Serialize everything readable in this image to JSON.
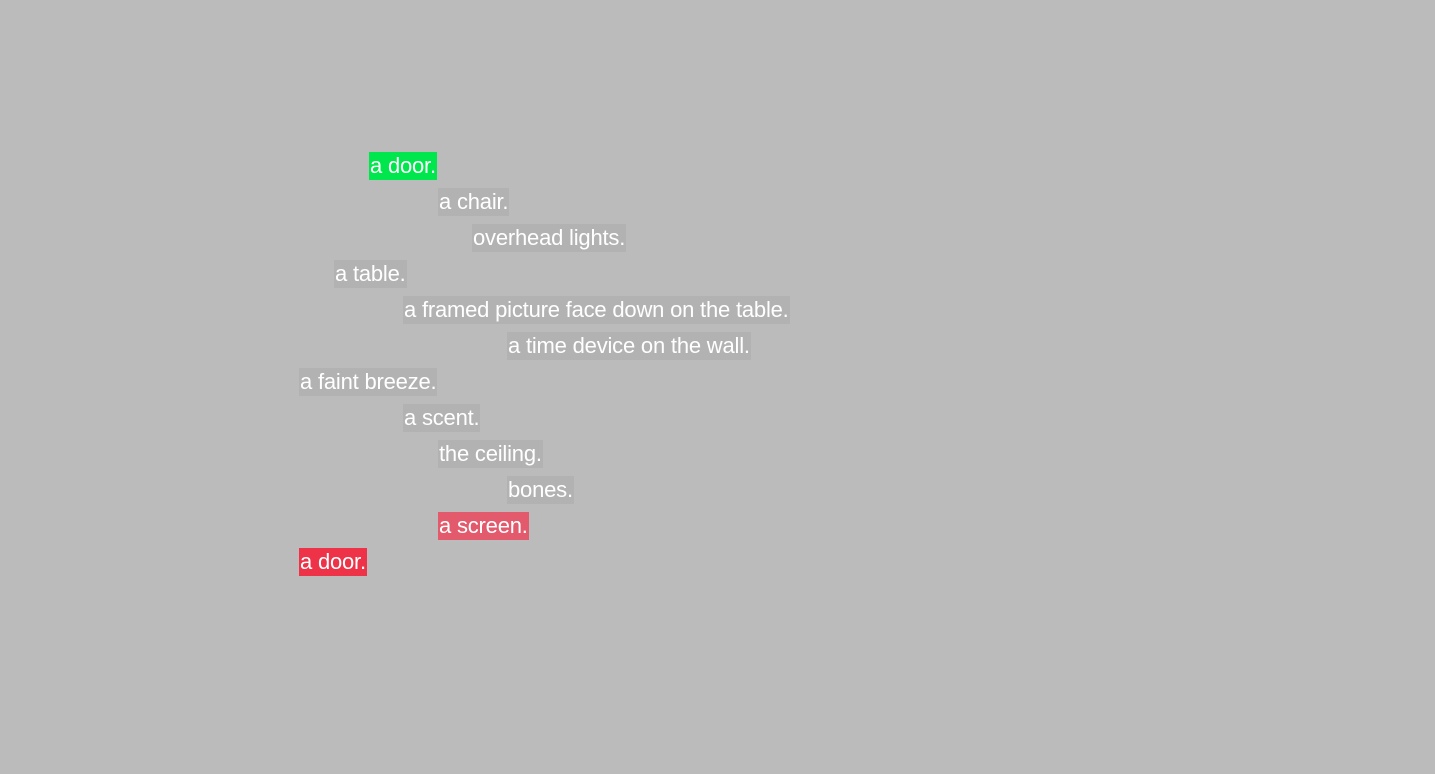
{
  "colors": {
    "background": "#bbbbbb",
    "text": "#ffffff",
    "neutral_highlight": "#b2b2b2",
    "start_highlight": "#00e64d",
    "visited_highlight": "#e25a6c",
    "current_highlight": "#ee3349"
  },
  "items": [
    {
      "text": "a door.",
      "state": "start"
    },
    {
      "text": "a chair.",
      "state": "neutral"
    },
    {
      "text": "overhead lights.",
      "state": "neutral"
    },
    {
      "text": "a table.",
      "state": "neutral"
    },
    {
      "text": "a framed picture face down on the table.",
      "state": "neutral"
    },
    {
      "text": "a time device on the wall.",
      "state": "neutral"
    },
    {
      "text": "a faint breeze.",
      "state": "neutral"
    },
    {
      "text": "a scent.",
      "state": "neutral"
    },
    {
      "text": "the ceiling.",
      "state": "neutral"
    },
    {
      "text": "bones.",
      "state": "neutral"
    },
    {
      "text": "a screen.",
      "state": "visited"
    },
    {
      "text": "a door.",
      "state": "current"
    }
  ]
}
